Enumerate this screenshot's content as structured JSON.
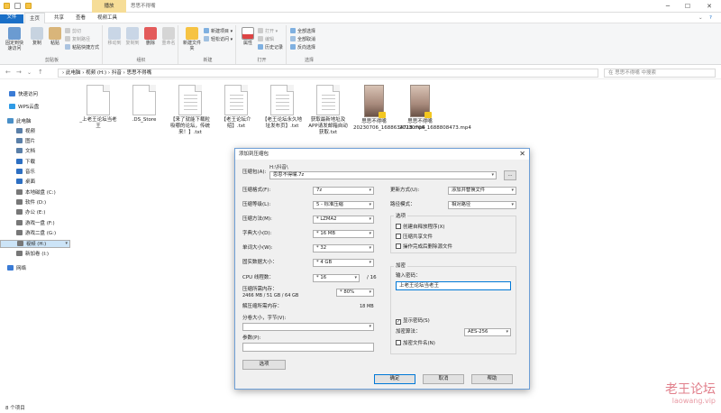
{
  "window": {
    "context_tab": "播放",
    "title": "思思不得嘴"
  },
  "tabs": [
    "文件",
    "主页",
    "共享",
    "查看",
    "视频工具"
  ],
  "ribbon": {
    "clipboard": {
      "pin": "固定到快速访问",
      "copy": "复制",
      "paste": "粘贴",
      "cut": "剪切",
      "copy_path": "复制路径",
      "paste_shortcut": "粘贴快捷方式",
      "label": "剪贴板"
    },
    "organize": {
      "move_to": "移动到",
      "copy_to": "复制到",
      "delete": "删除",
      "rename": "重命名",
      "label": "组织"
    },
    "new": {
      "new_folder": "新建文件夹",
      "new_item": "新建项目 ▾",
      "easy_access": "轻松访问 ▾",
      "label": "新建"
    },
    "open": {
      "properties": "属性",
      "open": "打开 ▾",
      "edit": "编辑",
      "history": "历史记录",
      "label": "打开"
    },
    "select": {
      "select_all": "全部选择",
      "select_none": "全部取消",
      "invert": "反向选择",
      "label": "选择"
    }
  },
  "address": {
    "path": "›  此电脑  ›  视频 (H:)  ›  抖音  ›  思思不得嘴",
    "search_placeholder": "在 思思不得嘴 中搜索"
  },
  "sidebar": [
    {
      "label": "快速访问",
      "color": "#3a7bd5"
    },
    {
      "label": "WPS云盘",
      "color": "#2f9be6"
    },
    {
      "label": "此电脑",
      "color": "#4a90c8"
    },
    {
      "label": "视频",
      "color": "#5a7fa8"
    },
    {
      "label": "图片",
      "color": "#5a7fa8"
    },
    {
      "label": "文档",
      "color": "#5a7fa8"
    },
    {
      "label": "下载",
      "color": "#2d6fc2"
    },
    {
      "label": "音乐",
      "color": "#2d6fc2"
    },
    {
      "label": "桌面",
      "color": "#2d6fc2"
    },
    {
      "label": "本地磁盘 (C:)",
      "color": "#777777"
    },
    {
      "label": "软件 (D:)",
      "color": "#777777"
    },
    {
      "label": "办公 (E:)",
      "color": "#777777"
    },
    {
      "label": "游戏一盘 (F:)",
      "color": "#777777"
    },
    {
      "label": "游戏二盘 (G:)",
      "color": "#777777"
    },
    {
      "label": "视频 (H:)",
      "color": "#777777"
    },
    {
      "label": "新加卷 (I:)",
      "color": "#777777"
    },
    {
      "label": "网络",
      "color": "#3a7bd5"
    }
  ],
  "files": [
    {
      "name": "_上老王论坛当老王",
      "type": "doc"
    },
    {
      "name": ".DS_Store",
      "type": "doc"
    },
    {
      "name": "【来了就能下载粒吸哪的论坛，传统来！】.txt",
      "type": "doc"
    },
    {
      "name": "【老王论坛介绍】.txt",
      "type": "doc"
    },
    {
      "name": "【老王论坛永久地址发布页】.txt",
      "type": "doc"
    },
    {
      "name": "获取最新地址及APP请发邮箱自动获取.txt",
      "type": "doc"
    },
    {
      "name": "思思不得嘴20230706_1688634718.mp4",
      "type": "video"
    },
    {
      "name": "思思不得嘴20230706_1688808473.mp4",
      "type": "video"
    }
  ],
  "status": "8 个项目",
  "watermark": {
    "text": "老王论坛",
    "url": "laowang.vip"
  },
  "dialog": {
    "title": "添加到压缩包",
    "archive_label": "压缩包(A):",
    "archive_dir": "H:\\抖音\\",
    "archive_name": "思思不得嘴.7z",
    "browse": "...",
    "format_label": "压缩格式(F):",
    "format": "7z",
    "level_label": "压缩等级(L):",
    "level": "5 - 标准压缩",
    "method_label": "压缩方法(M):",
    "method": "* LZMA2",
    "dict_label": "字典大小(D):",
    "dict": "* 16 MB",
    "word_label": "单词大小(W):",
    "word": "* 32",
    "solid_label": "固实数据大小：",
    "solid": "* 4 GB",
    "threads_label": "CPU 线程数：",
    "threads": "* 16",
    "threads_total": "/ 16",
    "mem_label": "压缩所需内存：",
    "mem_value": "2466 MB / 51 GB / 64 GB",
    "mem_pct": "* 80%",
    "decomp_label": "解压缩所需内存：",
    "decomp_value": "18 MB",
    "split_label": "分卷大小，字节(V):",
    "params_label": "参数(P):",
    "options_btn": "选项",
    "update_label": "更新方式(U):",
    "update": "添加并替换文件",
    "path_label": "路径模式：",
    "path": "相对路径",
    "opt_title": "选项",
    "opt_sfx": "创建自释放程序(X)",
    "opt_shared": "压缩共享文件",
    "opt_delete": "操作完成后删除源文件",
    "enc_title": "加密",
    "pwd_label": "输入密码：",
    "pwd": "上老王论坛当老王",
    "show_pwd": "显示密码(S)",
    "enc_method_label": "加密算法：",
    "enc_method": "AES-256",
    "enc_names": "加密文件名(N)",
    "ok": "确定",
    "cancel": "取消",
    "help": "帮助"
  }
}
